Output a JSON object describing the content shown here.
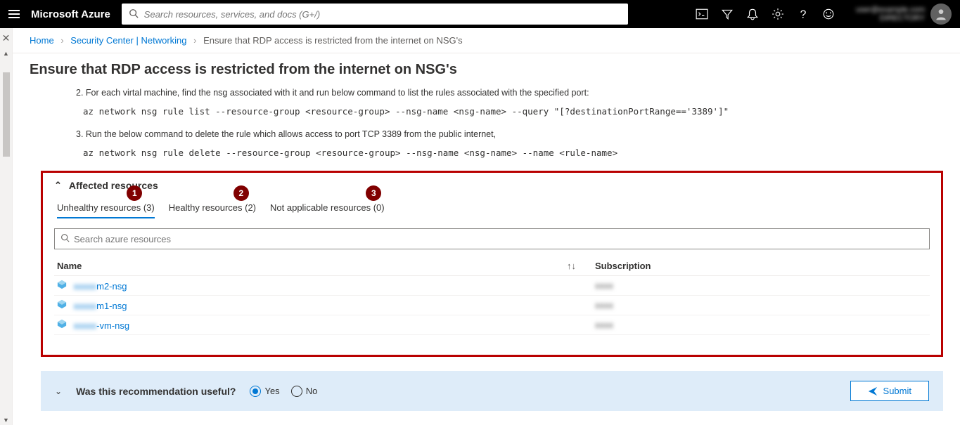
{
  "topbar": {
    "brand": "Microsoft Azure",
    "search_placeholder": "Search resources, services, and docs (G+/)",
    "account_line1": "user@example.com",
    "account_line2": "DIRECTORY"
  },
  "breadcrumb": {
    "home": "Home",
    "l2": "Security Center | Networking",
    "current": "Ensure that RDP access is restricted from the internet on NSG's"
  },
  "page_title": "Ensure that RDP access is restricted from the internet on NSG's",
  "remediation": {
    "step2": "2. For each virtal machine, find the nsg associated with it and run below command to list the rules associated with the specified port:",
    "cmd2": "az network nsg rule list --resource-group <resource-group> --nsg-name <nsg-name> --query \"[?destinationPortRange=='3389']\"",
    "step3": "3. Run the below command to delete the rule which allows access to port TCP  3389  from the public internet,",
    "cmd3": "az network nsg rule delete --resource-group <resource-group> --nsg-name <nsg-name> --name <rule-name>"
  },
  "affected": {
    "title": "Affected resources",
    "tabs": [
      {
        "label": "Unhealthy resources (3)",
        "marker": "1"
      },
      {
        "label": "Healthy resources (2)",
        "marker": "2"
      },
      {
        "label": "Not applicable resources (0)",
        "marker": "3"
      }
    ],
    "search_placeholder": "Search azure resources",
    "columns": {
      "name": "Name",
      "subscription": "Subscription"
    },
    "rows": [
      {
        "prefix": "xxxxx",
        "name": "m2-nsg",
        "sub": "xxxx"
      },
      {
        "prefix": "xxxxx",
        "name": "m1-nsg",
        "sub": "xxxx"
      },
      {
        "prefix": "xxxxx",
        "name": "-vm-nsg",
        "sub": "xxxx"
      }
    ]
  },
  "feedback": {
    "question": "Was this recommendation useful?",
    "yes": "Yes",
    "no": "No",
    "submit": "Submit"
  }
}
